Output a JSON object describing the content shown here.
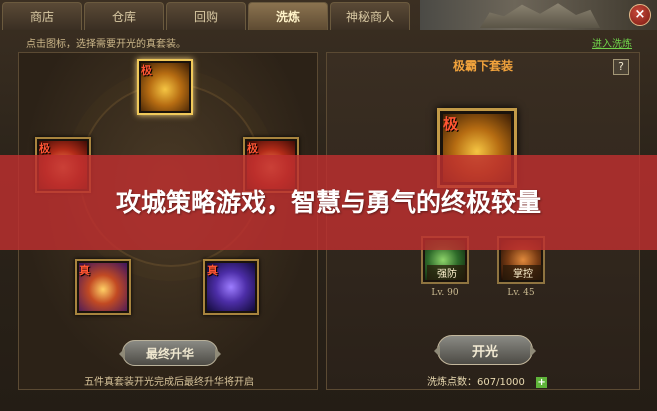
{
  "tabs": [
    {
      "label": "商店",
      "active": false
    },
    {
      "label": "仓库",
      "active": false
    },
    {
      "label": "回购",
      "active": false
    },
    {
      "label": "洗炼",
      "active": true
    },
    {
      "label": "神秘商人",
      "active": false
    }
  ],
  "close": {
    "label": "×",
    "icon": "close-icon"
  },
  "hint": {
    "text": "点击图标，选择需要开光的真套装。",
    "link": "进入洗炼"
  },
  "left_panel": {
    "slots": [
      {
        "tag": "极",
        "icon": "golden-dragon-icon"
      },
      {
        "tag": "极",
        "icon": "red-beast-icon"
      },
      {
        "tag": "极",
        "icon": "red-lion-icon"
      },
      {
        "tag": "真",
        "icon": "fire-phoenix-icon"
      },
      {
        "tag": "真",
        "icon": "purple-dragon-icon"
      }
    ],
    "upgrade_button": "最终升华",
    "note": "五件真套装开光完成后最终升华将开启"
  },
  "right_panel": {
    "title": "极霸下套装",
    "help": "?",
    "main_item": {
      "tag": "极",
      "icon": "golden-dragon-icon"
    },
    "attributes": [
      {
        "label": "强防",
        "level": "Lv. 90",
        "icon": "green-scroll-icon"
      },
      {
        "label": "掌控",
        "level": "Lv. 45",
        "icon": "brown-beast-icon"
      }
    ],
    "reforge_button": "开光",
    "points": {
      "label": "洗炼点数：607/1000",
      "plus": "+"
    }
  },
  "banner": {
    "title": "攻城策略游戏，智慧与勇气的终极较量"
  },
  "colors": {
    "banner": "#be3030",
    "accent": "#f0a23c",
    "link": "#6fd24a"
  }
}
